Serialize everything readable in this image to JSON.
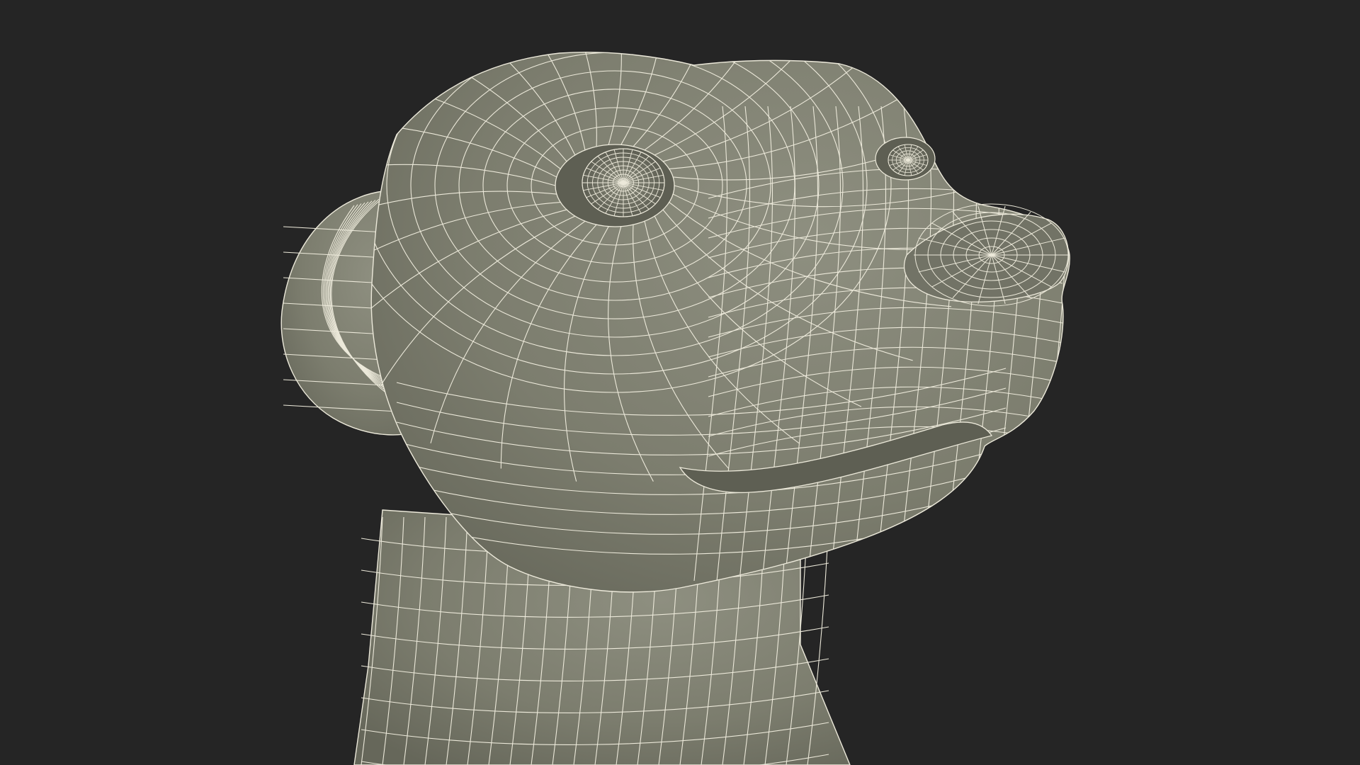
{
  "scene": {
    "subject": "otter-head-wireframe",
    "view": "three-quarter",
    "colors": {
      "background": "#252525",
      "surface": "#7c7d6e",
      "surface_light": "#8e8f80",
      "surface_shadow": "#5e5f53",
      "wire": "#ece9da"
    }
  }
}
